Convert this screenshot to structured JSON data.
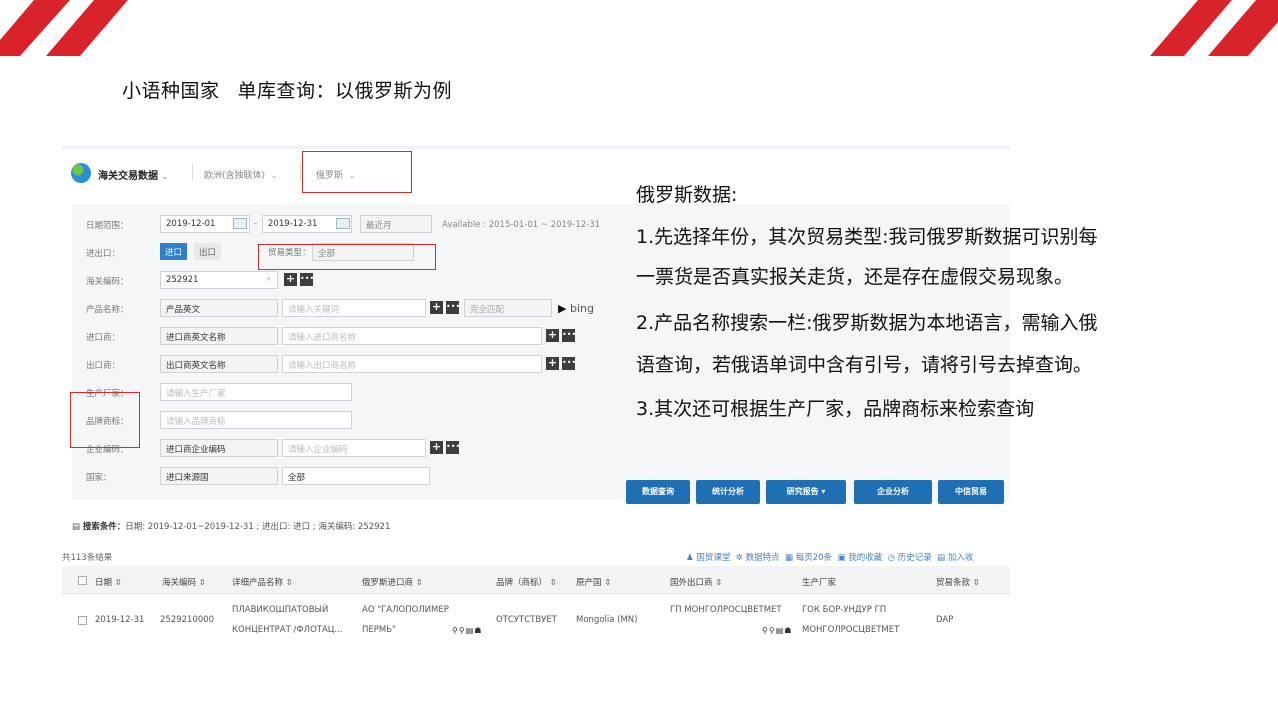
{
  "slide": {
    "title_part1": "小语种国家",
    "title_part2": "单库查询：以俄罗斯为例",
    "accent_color": "#d9232a"
  },
  "topbar": {
    "brand": "海关交易数据",
    "region": "欧洲(含独联体)",
    "country": "俄罗斯",
    "globe_icon": "globe-icon"
  },
  "form": {
    "date": {
      "label": "日期范围：",
      "from": "2019-12-01",
      "to": "2019-12-31",
      "recent": "最近月",
      "available": "Available : 2015-01-01 ~ 2019-12-31"
    },
    "direction": {
      "label": "进出口：",
      "import": "进口",
      "export": "出口",
      "trade_type_label": "贸易类型：",
      "trade_type_value": "全部"
    },
    "hs": {
      "label": "海关编码：",
      "value": "252921"
    },
    "product": {
      "label": "产品名称：",
      "select": "产品英文",
      "placeholder": "请输入关键词",
      "match": "完全匹配",
      "bing": "bing"
    },
    "importer": {
      "label": "进口商：",
      "select": "进口商英文名称",
      "placeholder": "请输入进口商名称"
    },
    "exporter": {
      "label": "出口商：",
      "select": "出口商英文名称",
      "placeholder": "请输入出口商名称"
    },
    "manufacturer": {
      "label": "生产厂家：",
      "placeholder": "请输入生产厂家"
    },
    "brand": {
      "label": "品牌商标：",
      "placeholder": "请输入品牌商标"
    },
    "company_code": {
      "label": "企业编码：",
      "select": "进口商企业编码",
      "placeholder": "请输入企业编码"
    },
    "country": {
      "label": "国家：",
      "select": "进口来源国",
      "value": "全部"
    }
  },
  "actions": [
    "数据查询",
    "统计分析",
    "研究报告 ▾",
    "企业分析",
    "中信贸易"
  ],
  "conditions": {
    "label": "搜索条件：",
    "text": "日期: 2019-12-01~2019-12-31 ; 进出口: 进口 ; 海关编码: 252921"
  },
  "results": {
    "count": "共113条结果",
    "tools": [
      "国贸课堂",
      "数据特点",
      "每页20条",
      "我的收藏",
      "历史记录",
      "加入收"
    ],
    "columns": [
      "日期",
      "海关编码",
      "详细产品名称",
      "俄罗斯进口商",
      "品牌（商标）",
      "原产国",
      "国外出口商",
      "生产厂家",
      "贸易条款"
    ],
    "row": {
      "date": "2019-12-31",
      "hs": "2529210000",
      "product_1": "ПЛАВИКОШПАТОВЫЙ",
      "product_2": "КОНЦЕНТРАТ /ФЛОТАЦ...",
      "importer_1": "АО \"ГАЛОПОЛИМЕР",
      "importer_2": "ПЕРМЬ\"",
      "brand": "ОТСУТСТВУЕТ",
      "origin": "Mongolia (MN)",
      "exporter": "ГП МОНГОЛРОСЦВЕТМЕТ",
      "maker_1": "ГОК БОР-УНДУР ГП",
      "maker_2": "МОНГОЛРОСЦВЕТМЕТ",
      "terms": "DAP"
    }
  },
  "notes": {
    "heading": "俄罗斯数据:",
    "line1": "1.先选择年份，其次贸易类型:我司俄罗斯数据可识别每",
    "line2": "一票货是否真实报关走货，还是存在虚假交易现象。",
    "line3": "2.产品名称搜索一栏:俄罗斯数据为本地语言，需输入俄",
    "line4": "语查询，若俄语单词中含有引号，请将引号去掉查询。",
    "line5": "3.其次还可根据生产厂家，品牌商标来检索查询"
  }
}
